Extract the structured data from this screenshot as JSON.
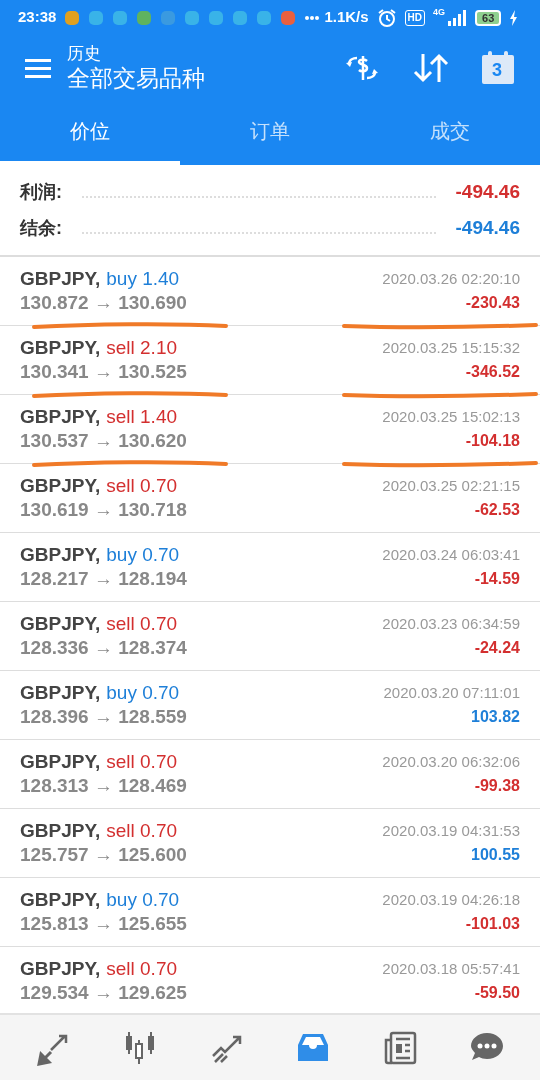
{
  "status_bar": {
    "time": "23:38",
    "speed": "1.1K/s",
    "hd": "HD",
    "network": "4G",
    "battery": "63"
  },
  "header": {
    "subtitle": "历史",
    "title": "全部交易品种",
    "calendar_day": "3"
  },
  "tabs": [
    {
      "label": "价位",
      "selected": true
    },
    {
      "label": "订单",
      "selected": false
    },
    {
      "label": "成交",
      "selected": false
    }
  ],
  "summary": [
    {
      "label": "利润:",
      "value": "-494.46",
      "color": "#d32f2f"
    },
    {
      "label": "结余:",
      "value": "-494.46",
      "color": "#1e7fd8"
    }
  ],
  "trades": [
    {
      "symbol": "GBPJPY,",
      "type": "buy",
      "volume": "1.40",
      "prices": "130.872 → 130.690",
      "time": "2020.03.26 02:20:10",
      "profit": "-230.43",
      "color": "#d32f2f",
      "marked": true
    },
    {
      "symbol": "GBPJPY,",
      "type": "sell",
      "volume": "2.10",
      "prices": "130.341 → 130.525",
      "time": "2020.03.25 15:15:32",
      "profit": "-346.52",
      "color": "#d32f2f",
      "marked": true
    },
    {
      "symbol": "GBPJPY,",
      "type": "sell",
      "volume": "1.40",
      "prices": "130.537 → 130.620",
      "time": "2020.03.25 15:02:13",
      "profit": "-104.18",
      "color": "#d32f2f",
      "marked": true
    },
    {
      "symbol": "GBPJPY,",
      "type": "sell",
      "volume": "0.70",
      "prices": "130.619 → 130.718",
      "time": "2020.03.25 02:21:15",
      "profit": "-62.53",
      "color": "#d32f2f",
      "marked": false
    },
    {
      "symbol": "GBPJPY,",
      "type": "buy",
      "volume": "0.70",
      "prices": "128.217 → 128.194",
      "time": "2020.03.24 06:03:41",
      "profit": "-14.59",
      "color": "#d32f2f",
      "marked": false
    },
    {
      "symbol": "GBPJPY,",
      "type": "sell",
      "volume": "0.70",
      "prices": "128.336 → 128.374",
      "time": "2020.03.23 06:34:59",
      "profit": "-24.24",
      "color": "#d32f2f",
      "marked": false
    },
    {
      "symbol": "GBPJPY,",
      "type": "buy",
      "volume": "0.70",
      "prices": "128.396 → 128.559",
      "time": "2020.03.20 07:11:01",
      "profit": "103.82",
      "color": "#1e7fd8",
      "marked": false
    },
    {
      "symbol": "GBPJPY,",
      "type": "sell",
      "volume": "0.70",
      "prices": "128.313 → 128.469",
      "time": "2020.03.20 06:32:06",
      "profit": "-99.38",
      "color": "#d32f2f",
      "marked": false
    },
    {
      "symbol": "GBPJPY,",
      "type": "sell",
      "volume": "0.70",
      "prices": "125.757 → 125.600",
      "time": "2020.03.19 04:31:53",
      "profit": "100.55",
      "color": "#1e7fd8",
      "marked": false
    },
    {
      "symbol": "GBPJPY,",
      "type": "buy",
      "volume": "0.70",
      "prices": "125.813 → 125.655",
      "time": "2020.03.19 04:26:18",
      "profit": "-101.03",
      "color": "#d32f2f",
      "marked": false
    },
    {
      "symbol": "GBPJPY,",
      "type": "sell",
      "volume": "0.70",
      "prices": "129.534 → 129.625",
      "time": "2020.03.18 05:57:41",
      "profit": "-59.50",
      "color": "#d32f2f",
      "marked": false
    }
  ],
  "bottom_nav": [
    {
      "kind": "quotes",
      "selected": false
    },
    {
      "kind": "chart",
      "selected": false
    },
    {
      "kind": "trade",
      "selected": false
    },
    {
      "kind": "history",
      "selected": true
    },
    {
      "kind": "news",
      "selected": false
    },
    {
      "kind": "chat",
      "selected": false
    }
  ]
}
